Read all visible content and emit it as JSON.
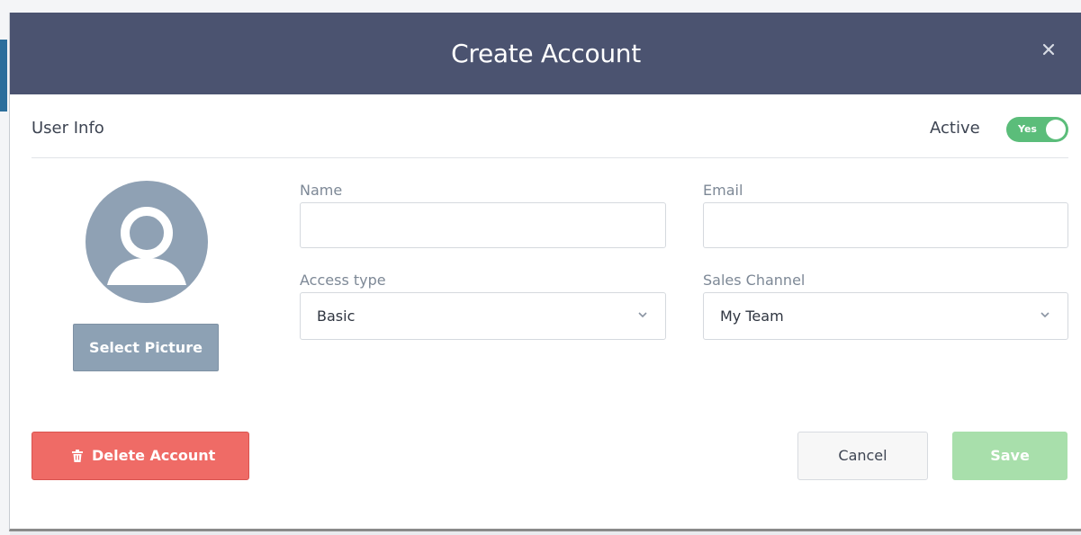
{
  "modal": {
    "title": "Create Account",
    "close_icon": "close-icon"
  },
  "user_info": {
    "section_label": "User Info",
    "active_label": "Active",
    "active_toggle": {
      "label": "Yes",
      "on": true,
      "color": "#5bbd7a"
    }
  },
  "avatar": {
    "icon": "user-avatar-icon",
    "select_label": "Select Picture"
  },
  "form": {
    "name": {
      "label": "Name",
      "value": "",
      "placeholder": ""
    },
    "email": {
      "label": "Email",
      "value": "",
      "placeholder": ""
    },
    "access_type": {
      "label": "Access type",
      "selected": "Basic"
    },
    "sales_channel": {
      "label": "Sales Channel",
      "selected": "My Team"
    }
  },
  "actions": {
    "delete_label": "Delete Account",
    "delete_icon": "trash-icon",
    "cancel_label": "Cancel",
    "save_label": "Save"
  },
  "colors": {
    "header_bg": "#4b5370",
    "danger": "#ef6b66",
    "save_disabled": "#a8dfab",
    "secondary": "#8da1b4"
  }
}
